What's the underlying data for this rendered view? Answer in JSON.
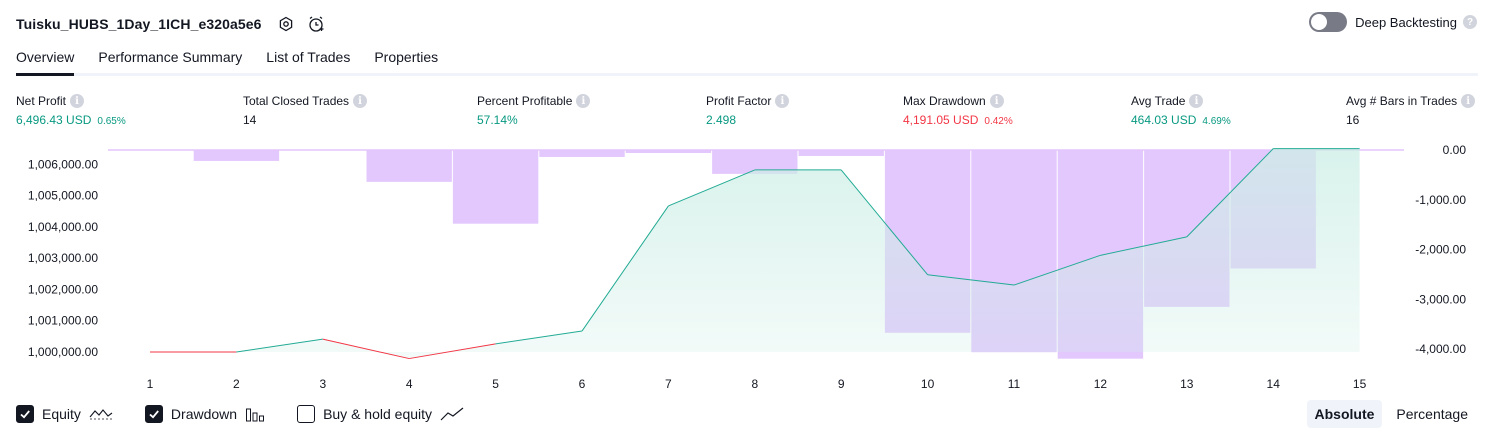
{
  "header": {
    "title": "Tuisku_HUBS_1Day_1ICH_e320a5e6",
    "deep_backtesting_label": "Deep Backtesting",
    "help_glyph": "?",
    "icons": [
      "settings-icon",
      "alarm-add-icon",
      "help-icon"
    ]
  },
  "tabs": [
    {
      "label": "Overview",
      "active": true
    },
    {
      "label": "Performance Summary",
      "active": false
    },
    {
      "label": "List of Trades",
      "active": false
    },
    {
      "label": "Properties",
      "active": false
    }
  ],
  "metrics": [
    {
      "label": "Net Profit",
      "value": "6,496.43 USD",
      "pct": "0.65%",
      "color": "green"
    },
    {
      "label": "Total Closed Trades",
      "value": "14",
      "pct": "",
      "color": "dark"
    },
    {
      "label": "Percent Profitable",
      "value": "57.14%",
      "pct": "",
      "color": "green"
    },
    {
      "label": "Profit Factor",
      "value": "2.498",
      "pct": "",
      "color": "green"
    },
    {
      "label": "Max Drawdown",
      "value": "4,191.05 USD",
      "pct": "0.42%",
      "color": "red"
    },
    {
      "label": "Avg Trade",
      "value": "464.03 USD",
      "pct": "4.69%",
      "color": "green"
    },
    {
      "label": "Avg # Bars in Trades",
      "value": "16",
      "pct": "",
      "color": "dark"
    }
  ],
  "info_glyph": "i",
  "chart_data": {
    "type": "area",
    "x": [
      1,
      2,
      3,
      4,
      5,
      6,
      7,
      8,
      9,
      10,
      11,
      12,
      13,
      14,
      15
    ],
    "series": [
      {
        "name": "Equity",
        "type": "area",
        "values": [
          1000000,
          1000000,
          1000410,
          999790,
          1000260,
          1000670,
          1004670,
          1005820,
          1005820,
          1002470,
          1002140,
          1003090,
          1003680,
          1006500,
          1006500
        ]
      },
      {
        "name": "Drawdown",
        "type": "bar",
        "values": [
          0,
          -220,
          0,
          -640,
          -1480,
          -140,
          -60,
          -480,
          -120,
          -3670,
          -4060,
          -4190,
          -3150,
          -2380,
          0
        ]
      }
    ],
    "left_axis_ticks": [
      "1,006,000.00",
      "1,005,000.00",
      "1,004,000.00",
      "1,003,000.00",
      "1,002,000.00",
      "1,001,000.00",
      "1,000,000.00"
    ],
    "left_axis_tick_values": [
      1006000,
      1005000,
      1004000,
      1003000,
      1002000,
      1001000,
      1000000
    ],
    "right_axis_ticks": [
      "0.00",
      "-1,000.00",
      "-2,000.00",
      "-3,000.00",
      "-4,000.00"
    ],
    "right_axis_tick_values": [
      0,
      -1000,
      -2000,
      -3000,
      -4000
    ],
    "x_tick_labels": [
      "1",
      "2",
      "3",
      "4",
      "5",
      "6",
      "7",
      "8",
      "9",
      "10",
      "11",
      "12",
      "13",
      "14",
      "15"
    ],
    "colors": {
      "equity_up": "#22ab94",
      "equity_down": "#f23645",
      "equity_fill": "#cdeee6",
      "drawdown_fill": "#e1c5fd",
      "drawdown_line": "#d6a8fb"
    }
  },
  "legend": [
    {
      "label": "Equity",
      "checked": true,
      "icon": "equity-line-icon"
    },
    {
      "label": "Drawdown",
      "checked": true,
      "icon": "drawdown-bars-icon"
    },
    {
      "label": "Buy & hold equity",
      "checked": false,
      "icon": "buy-hold-line-icon"
    }
  ],
  "mode": {
    "absolute_label": "Absolute",
    "percentage_label": "Percentage",
    "selected": "Absolute"
  }
}
